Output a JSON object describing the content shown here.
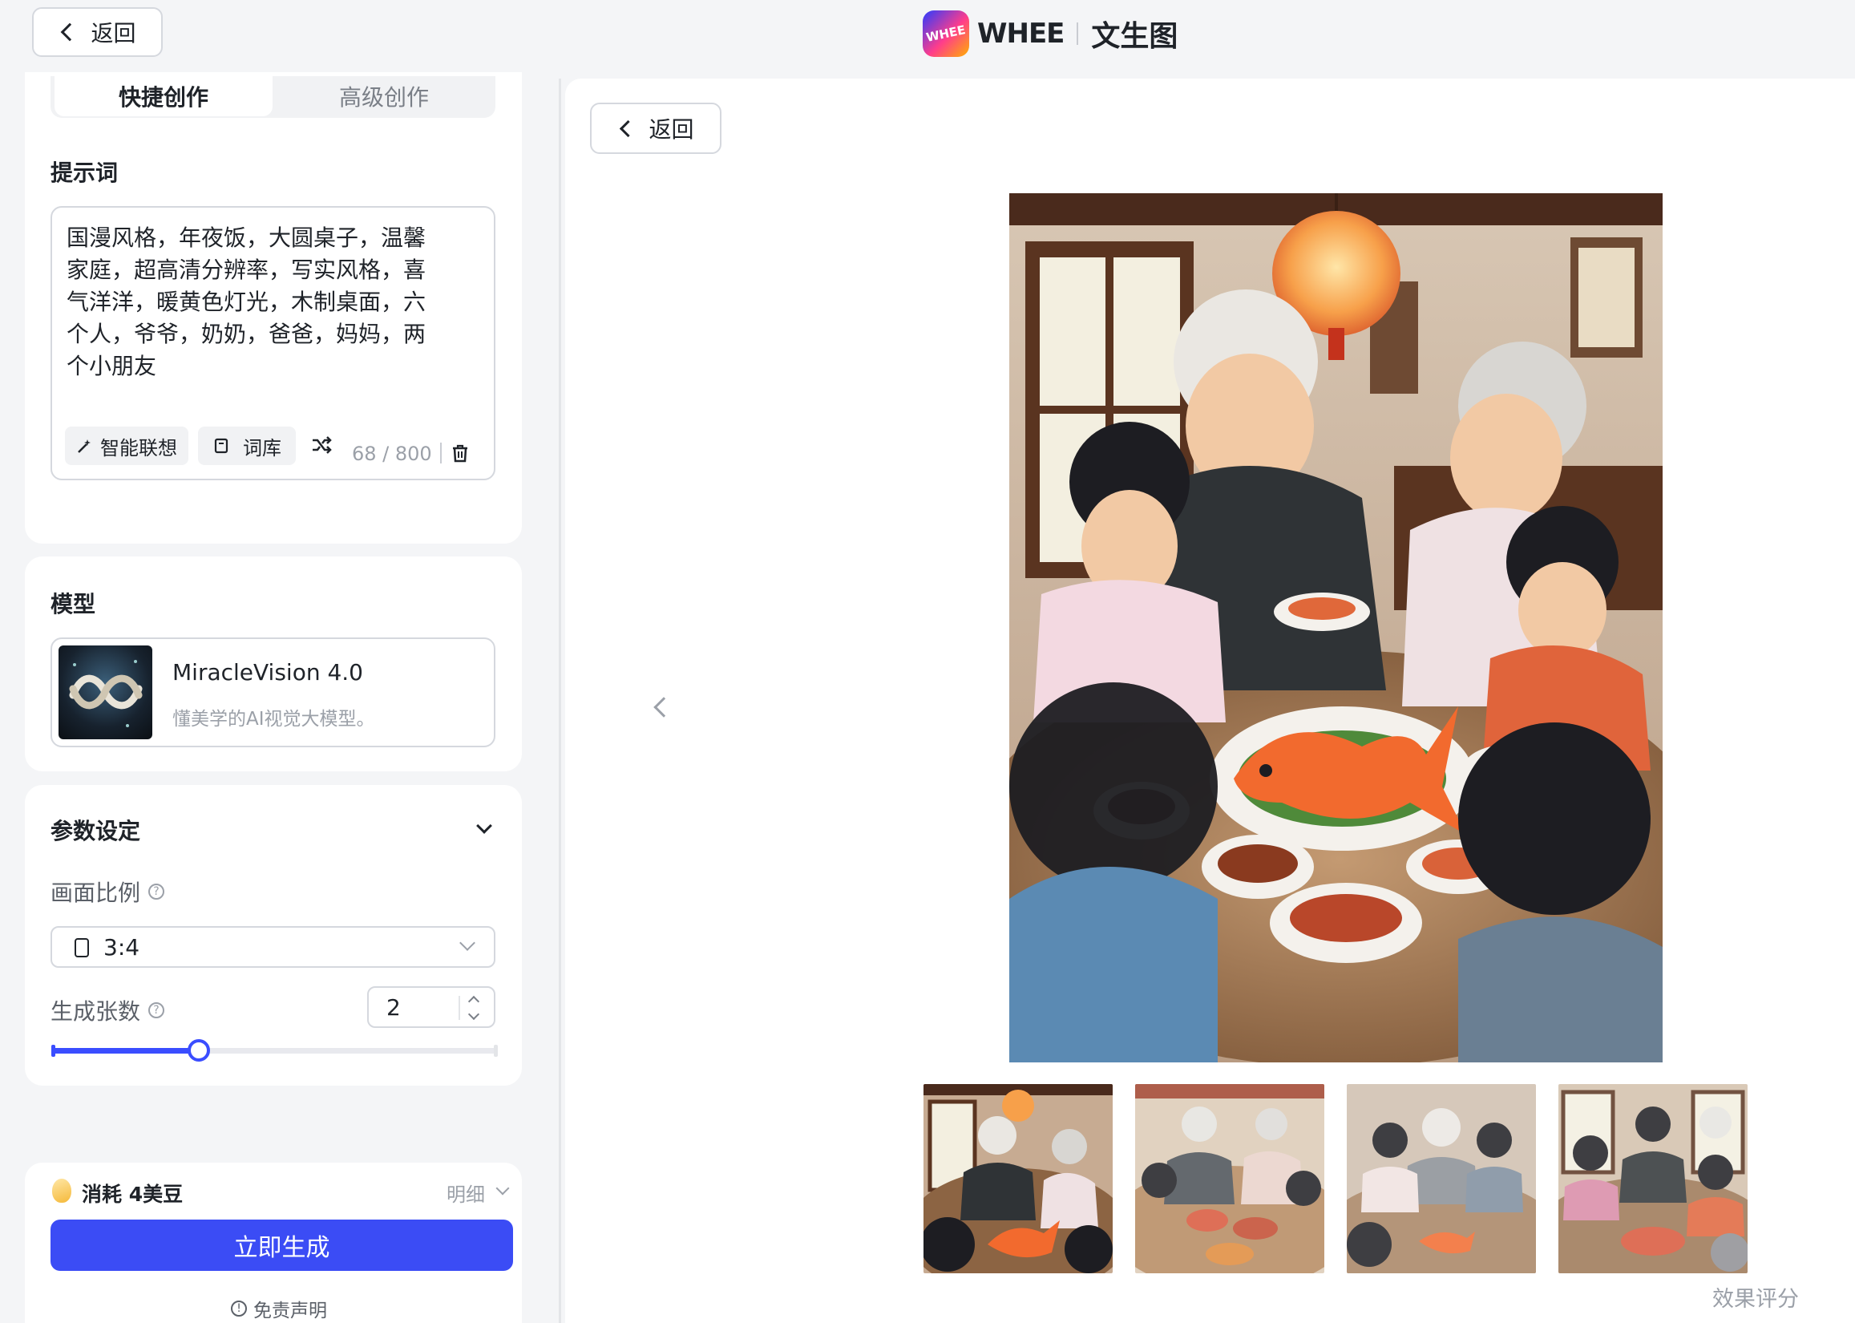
{
  "header": {
    "back_label": "返回",
    "logo_text": "WHEE",
    "brand": "WHEE",
    "page_title": "文生图"
  },
  "sidebar": {
    "tabs": [
      {
        "label": "快捷创作",
        "active": true
      },
      {
        "label": "高级创作",
        "active": false
      }
    ],
    "prompt": {
      "title": "提示词",
      "value": "国漫风格，年夜饭，大圆桌子，温馨家庭，超高清分辨率，写实风格，喜气洋洋，暖黄色灯光，木制桌面，六个人，爷爷，奶奶，爸爸，妈妈，两个小朋友",
      "smart_label": "智能联想",
      "library_label": "词库",
      "counter": "68 / 800"
    },
    "model": {
      "title": "模型",
      "name": "MiracleVision 4.0",
      "description": "懂美学的AI视觉大模型。"
    },
    "params": {
      "title": "参数设定",
      "aspect_label": "画面比例",
      "aspect_value": "3:4",
      "count_label": "生成张数",
      "count_value": "2",
      "slider_fraction": 0.33
    },
    "footer": {
      "cost_text": "消耗 4美豆",
      "detail_label": "明细",
      "generate_label": "立即生成",
      "disclaimer": "免责声明"
    }
  },
  "main": {
    "back_label": "返回",
    "rating_label": "效果评分",
    "image_count": 4,
    "selected_index": 0
  },
  "colors": {
    "accent": "#3b4cf5",
    "background": "#f4f5f7",
    "panel": "#ffffff",
    "border": "#d5d8de",
    "muted_text": "#9ba0a8"
  },
  "icons": [
    "chevron-left-icon",
    "whee-logo-icon",
    "magic-wand-icon",
    "book-icon",
    "shuffle-icon",
    "trash-icon",
    "chevron-down-icon",
    "help-icon",
    "portrait-icon",
    "bean-icon",
    "info-icon"
  ]
}
